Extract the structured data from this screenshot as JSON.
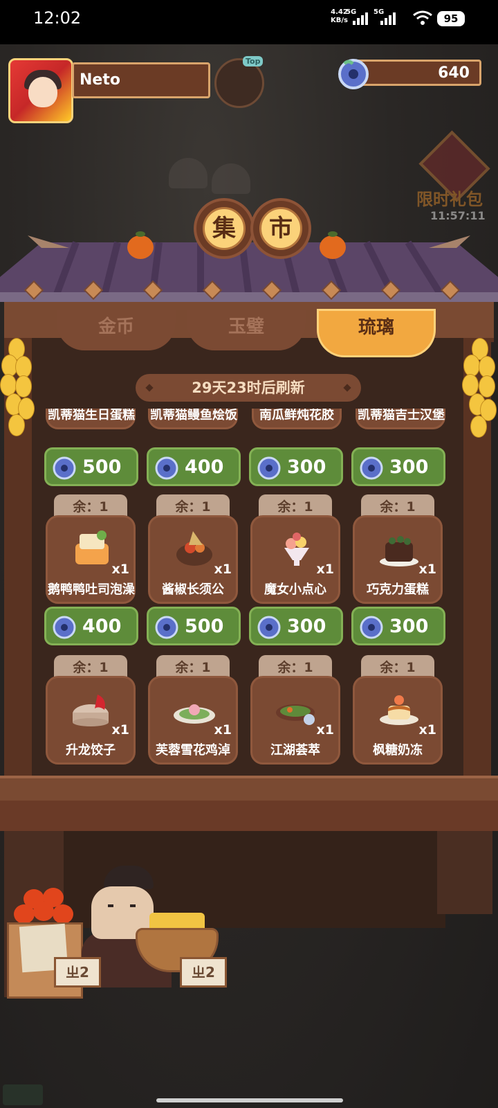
{
  "status_bar": {
    "time": "12:02",
    "net_speed_value": "4.42",
    "net_speed_unit": "KB/s",
    "signal1_label": "5G",
    "signal2_label": "5G",
    "battery": "95"
  },
  "hud": {
    "player_name": "Neto",
    "top_badge": "Top",
    "currency_value": "640"
  },
  "limited_pack": {
    "label": "限时礼包",
    "timer": "11:57:11"
  },
  "market": {
    "sign_char1": "集",
    "sign_char2": "市",
    "tabs": [
      {
        "label": "金币",
        "active": false
      },
      {
        "label": "玉璧",
        "active": false
      },
      {
        "label": "琉璃",
        "active": true
      }
    ],
    "refresh_text": "29天23时后刷新"
  },
  "partial_row": {
    "names": [
      "凯蒂猫生日蛋糕",
      "凯蒂猫鳗鱼烩饭",
      "南瓜鲜炖花胶",
      "凯蒂猫吉士汉堡"
    ],
    "prices": [
      "500",
      "400",
      "300",
      "300"
    ]
  },
  "items": [
    {
      "stock": "余：1",
      "name": "鹅鸭鸭吐司泡澡",
      "qty": "x1",
      "price": "400",
      "icon": "toast-bath-icon"
    },
    {
      "stock": "余：1",
      "name": "酱椒长须公",
      "qty": "x1",
      "price": "500",
      "icon": "pepper-shrimp-icon"
    },
    {
      "stock": "余：1",
      "name": "魔女小点心",
      "qty": "x1",
      "price": "300",
      "icon": "witch-dessert-icon"
    },
    {
      "stock": "余：1",
      "name": "巧克力蛋糕",
      "qty": "x1",
      "price": "300",
      "icon": "chocolate-cake-icon"
    },
    {
      "stock": "余：1",
      "name": "升龙饺子",
      "qty": "x1",
      "price": "",
      "icon": "dragon-dumpling-icon"
    },
    {
      "stock": "余：1",
      "name": "芙蓉雪花鸡淖",
      "qty": "x1",
      "price": "",
      "icon": "lotus-chicken-icon"
    },
    {
      "stock": "余：1",
      "name": "江湖荟萃",
      "qty": "x1",
      "price": "",
      "icon": "jianghu-platter-icon"
    },
    {
      "stock": "余：1",
      "name": "枫糖奶冻",
      "qty": "x1",
      "price": "",
      "icon": "maple-pudding-icon"
    }
  ],
  "stall": {
    "left_tag": "ㄓ2",
    "right_tag": "ㄓ2"
  },
  "colors": {
    "price_green": "#5e8c3a",
    "tab_active": "#f2a840",
    "panel": "#3a261d"
  }
}
